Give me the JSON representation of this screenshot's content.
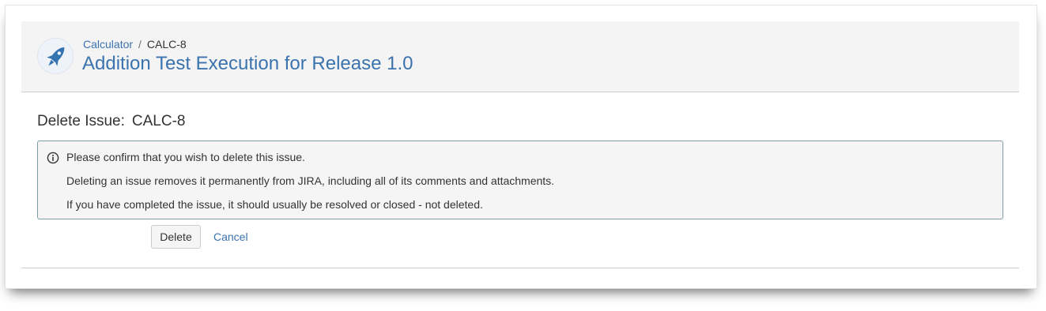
{
  "header": {
    "breadcrumb": {
      "project": "Calculator",
      "separator": "/",
      "issue_key": "CALC-8"
    },
    "title": "Addition Test Execution for Release 1.0",
    "avatar_icon": "rocket-icon"
  },
  "dialog": {
    "heading_label": "Delete Issue:",
    "heading_key": "CALC-8",
    "message": {
      "icon": "info-icon",
      "lines": [
        "Please confirm that you wish to delete this issue.",
        "Deleting an issue removes it permanently from JIRA, including all of its comments and attachments.",
        "If you have completed the issue, it should usually be resolved or closed - not deleted."
      ]
    },
    "buttons": {
      "delete_label": "Delete",
      "cancel_label": "Cancel"
    }
  },
  "colors": {
    "link": "#3b73af",
    "header_bg": "#f4f4f4",
    "message_border": "#7f9aa8",
    "text": "#333333"
  }
}
